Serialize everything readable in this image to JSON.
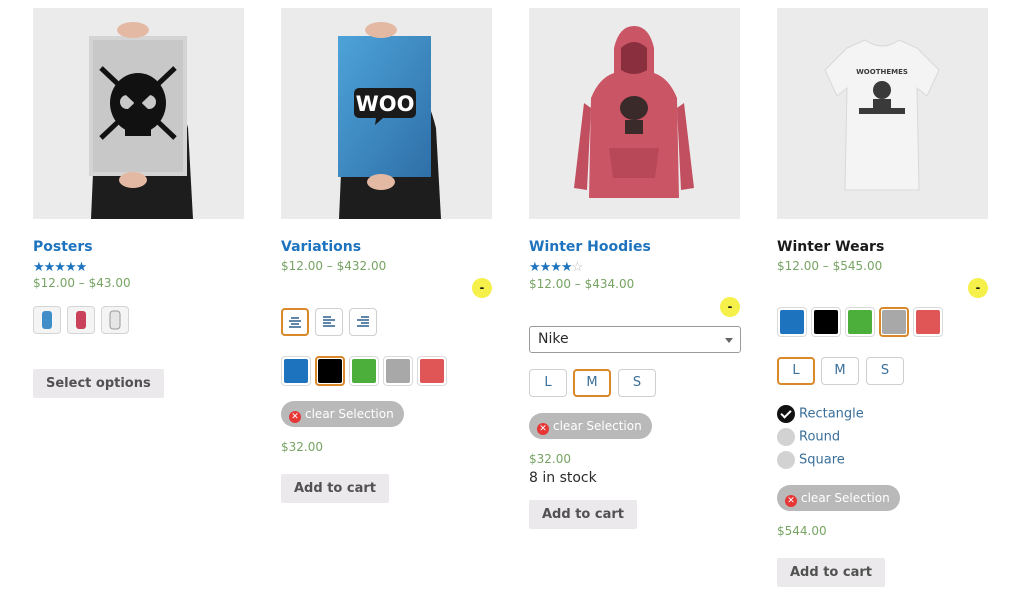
{
  "products": [
    {
      "title": "Posters",
      "rating_stars": "★★★★★",
      "rating": 5,
      "price": "$12.00 – $43.00",
      "button": "Select options",
      "image_icon": "poster-skull-image"
    },
    {
      "title": "Variations",
      "price": "$12.00 – $432.00",
      "badge": "-",
      "alignment_options": [
        "align-center-icon",
        "align-left-icon",
        "align-right-icon"
      ],
      "colors": [
        "#1e73be",
        "#000000",
        "#4caf3b",
        "#a8a8a8",
        "#e05555"
      ],
      "selected_color_index": 1,
      "clear_label": "clear Selection",
      "variation_price": "$32.00",
      "button": "Add to cart",
      "image_icon": "poster-woo-image"
    },
    {
      "title": "Winter Hoodies",
      "rating_stars_on": "★★★★",
      "rating_stars_off": "☆",
      "rating": 4,
      "price": "$12.00 – $434.00",
      "badge": "-",
      "brand_select": "Nike",
      "sizes": [
        "L",
        "M",
        "S"
      ],
      "selected_size": "M",
      "clear_label": "clear Selection",
      "variation_price": "$32.00",
      "stock": "8 in stock",
      "button": "Add to cart",
      "image_icon": "hoodie-image"
    },
    {
      "title": "Winter Wears",
      "price": "$12.00 – $545.00",
      "badge": "-",
      "colors": [
        "#1e73be",
        "#000000",
        "#4caf3b",
        "#a8a8a8",
        "#e05555"
      ],
      "selected_color_index": 3,
      "sizes": [
        "L",
        "M",
        "S"
      ],
      "selected_size": "L",
      "shapes": [
        "Rectangle",
        "Round",
        "Square"
      ],
      "selected_shape": "Rectangle",
      "clear_label": "clear Selection",
      "variation_price": "$544.00",
      "button": "Add to cart",
      "image_icon": "tshirt-image"
    }
  ]
}
